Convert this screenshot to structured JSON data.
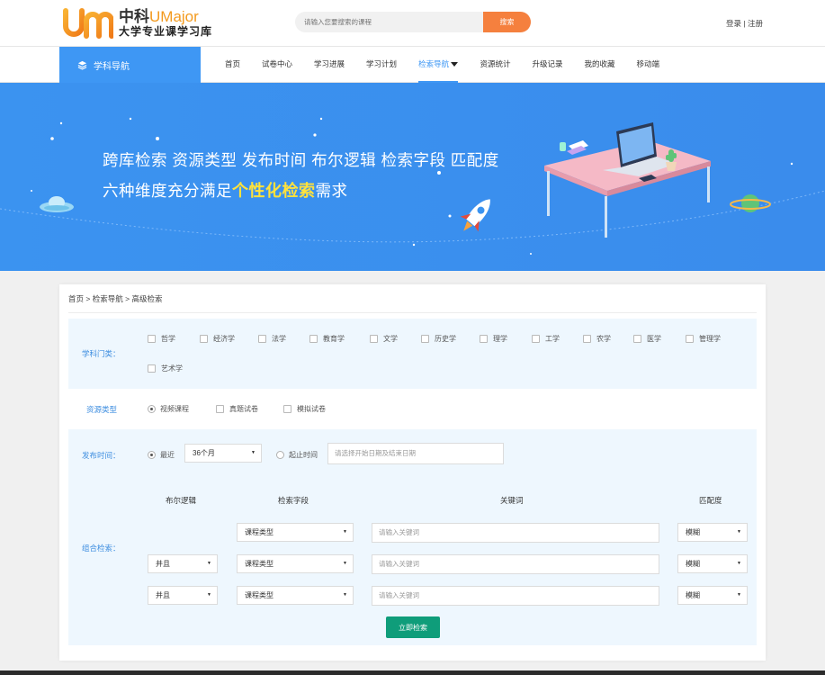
{
  "header": {
    "logo_cn": "中科",
    "logo_en": "UMajor",
    "logo_tagline": "大学专业课学习库",
    "search_placeholder": "请输入您要搜索的课程",
    "search_button": "搜索",
    "login": "登录",
    "separator": "|",
    "register": "注册"
  },
  "nav": {
    "subject_nav": "学科导航",
    "items": [
      {
        "label": "首页"
      },
      {
        "label": "试卷中心"
      },
      {
        "label": "学习进展"
      },
      {
        "label": "学习计划"
      },
      {
        "label": "检索导航"
      },
      {
        "label": "资源统计"
      },
      {
        "label": "升级记录"
      },
      {
        "label": "我的收藏"
      },
      {
        "label": "移动端"
      }
    ],
    "active_index": 4
  },
  "banner": {
    "line1": "跨库检索 资源类型 发布时间 布尔逻辑 检索字段 匹配度",
    "line2_prefix": "六种维度充分满足",
    "line2_highlight": "个性化检索",
    "line2_suffix": "需求"
  },
  "breadcrumb": {
    "home": "首页",
    "sep": ">",
    "nav": "检索导航",
    "current": "高级检索"
  },
  "subjects": {
    "label": "学科门类：",
    "items": [
      "哲学",
      "经济学",
      "法学",
      "教育学",
      "文学",
      "历史学",
      "理学",
      "工学",
      "农学",
      "医学",
      "管理学",
      "艺术学"
    ]
  },
  "resource_type": {
    "label": "资源类型",
    "options": [
      "视频课程",
      "真题试卷",
      "模拟试卷"
    ],
    "selected": 0
  },
  "publish_time": {
    "label": "发布时间：",
    "recent_label": "最近",
    "recent_value": "36个月",
    "range_label": "起止时间",
    "range_placeholder": "请选择开始日期及结束日期"
  },
  "combined": {
    "label": "组合检索：",
    "headers": {
      "bool": "布尔逻辑",
      "field": "检索字段",
      "keyword": "关键词",
      "match": "匹配度"
    },
    "rows": [
      {
        "bool": "",
        "field": "课程类型",
        "keyword_placeholder": "请输入关键词",
        "match": "模糊"
      },
      {
        "bool": "并且",
        "field": "课程类型",
        "keyword_placeholder": "请输入关键词",
        "match": "模糊"
      },
      {
        "bool": "并且",
        "field": "课程类型",
        "keyword_placeholder": "请输入关键词",
        "match": "模糊"
      }
    ],
    "submit": "立即检索"
  },
  "colors": {
    "primary": "#3e97f4",
    "orange": "#f5803e",
    "teal": "#0f9d7a",
    "highlight": "#ffe23c"
  }
}
